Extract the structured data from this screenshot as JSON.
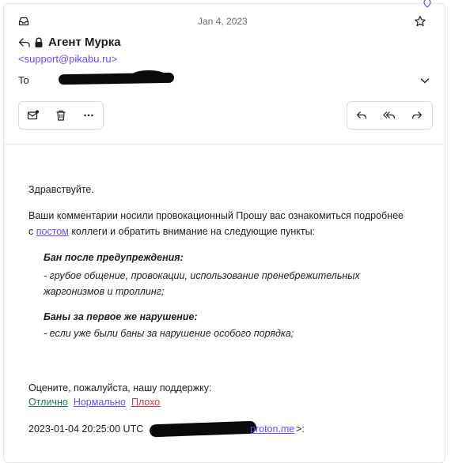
{
  "header": {
    "date": "Jan 4, 2023",
    "sender_name": "Агент Мурка",
    "sender_email": "<support@pikabu.ru>",
    "to_label": "To"
  },
  "body": {
    "greeting": "Здравствуйте.",
    "para_part1": "Ваши комментарии носили провокационный Прошу вас ознакомиться подробнее с ",
    "para_link": "постом",
    "para_part2": " коллеги и обратить внимание на следующие пункты:",
    "rule1_title": "Бан после предупреждения:",
    "rule1_text": "- грубое общение, провокации, использование пренебрежительных жаргонизмов и троллинг;",
    "rule2_title": "Баны за первое же нарушение:",
    "rule2_text": "- если уже были баны за нарушение особого порядка;",
    "rating_question": "Оцените, пожалуйста, нашу поддержку:",
    "rating_good": "Отлично",
    "rating_mid": "Нормально",
    "rating_bad": "Плохо",
    "quote_prefix": "2023-01-04 20:25:00 UTC",
    "quote_link_tail": "proton.me",
    "quote_suffix": ">:"
  },
  "icons": {
    "inbox": "inbox-icon",
    "star": "star-icon",
    "reply_arrow": "reply-indicator-icon",
    "lock": "lock-icon",
    "chevron": "chevron-down-icon",
    "mark_unread": "mark-unread-icon",
    "trash": "trash-icon",
    "more": "more-icon",
    "reply": "reply-icon",
    "reply_all": "reply-all-icon",
    "forward": "forward-icon"
  },
  "colors": {
    "accent": "#6d4aff",
    "good": "#18794e",
    "bad": "#d6334a"
  }
}
